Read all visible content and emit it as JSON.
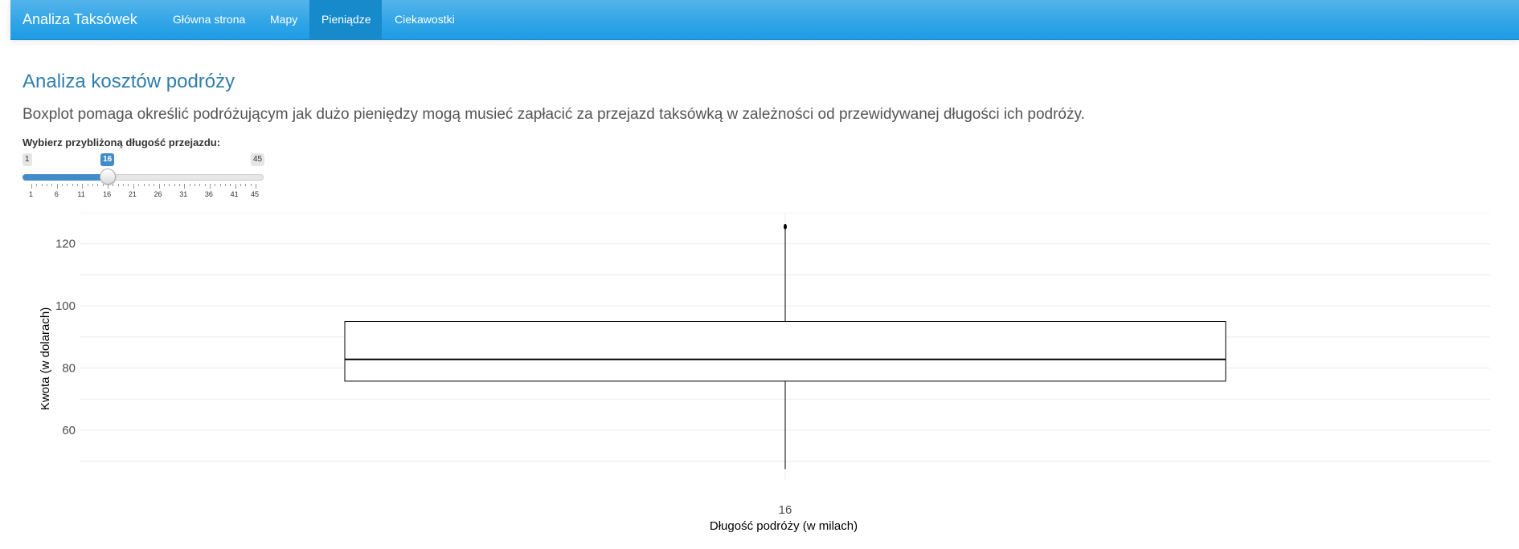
{
  "navbar": {
    "brand": "Analiza Taksówek",
    "items": [
      {
        "label": "Główna strona",
        "active": false
      },
      {
        "label": "Mapy",
        "active": false
      },
      {
        "label": "Pieniądze",
        "active": true
      },
      {
        "label": "Ciekawostki",
        "active": false
      }
    ]
  },
  "page": {
    "title": "Analiza kosztów podróży",
    "intro": "Boxplot pomaga określić podróżującym jak dużo pieniędzy mogą musieć zapłacić za przejazd taksówką w zależności od przewidywanej długości ich podróży."
  },
  "slider": {
    "label": "Wybierz przybliżoną długość przejazdu:",
    "min": 1,
    "max": 45,
    "value": 16,
    "tick_labels": [
      "1",
      "6",
      "11",
      "16",
      "21",
      "26",
      "31",
      "36",
      "41",
      "45"
    ],
    "min_label": "1",
    "max_label": "45",
    "value_label": "16"
  },
  "chart_data": {
    "type": "boxplot",
    "xlabel": "Długość podróży (w milach)",
    "ylabel": "Kwota (w dolarach)",
    "ylim": [
      44,
      130
    ],
    "yticks": [
      60,
      80,
      100,
      120
    ],
    "categories": [
      "16"
    ],
    "boxes": [
      {
        "category": "16",
        "whisker_low": 47.5,
        "q1": 75.8,
        "median": 82.8,
        "q3": 95,
        "whisker_high": 125,
        "outliers": [
          125.5
        ]
      }
    ],
    "grid": true,
    "colors": {
      "box_stroke": "#000000",
      "grid": "#ebebeb"
    }
  }
}
